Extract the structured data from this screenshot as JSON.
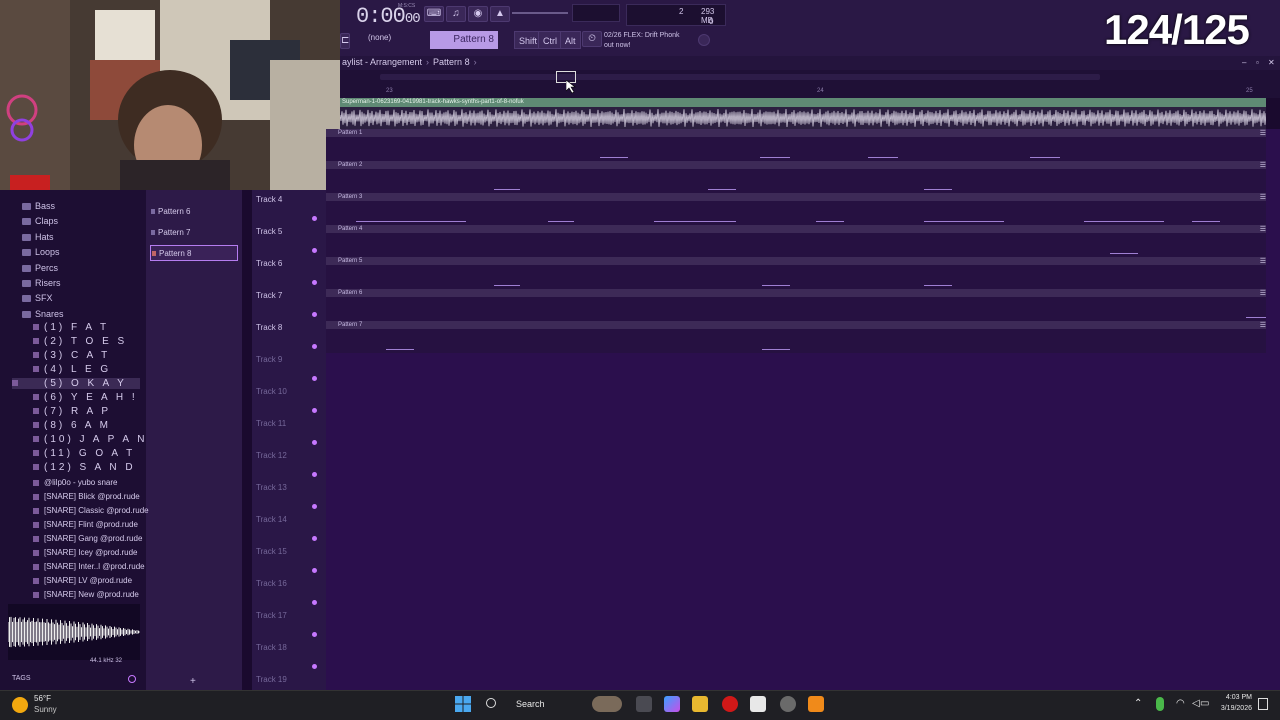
{
  "toolbar": {
    "time_main": "0:00",
    "time_sub": "00",
    "time_unit": "M:S:CS",
    "cpu_value": "2",
    "mem_value": "293 MB",
    "mem_sub": "0",
    "pattern_selector": "(none)",
    "pattern_current": "Pattern 8",
    "shift_label": "Shift",
    "ctrl_label": "Ctrl",
    "alt_label": "Alt",
    "news_line1": "02/26  FLEX: Drift Phonk",
    "news_line2": "out now!"
  },
  "overlay": {
    "counter": "124/125"
  },
  "playlist": {
    "breadcrumb_root": "aylist - Arrangement",
    "breadcrumb_current": "Pattern 8",
    "ruler_numbers": [
      "23",
      "24",
      "25"
    ],
    "audio_clip_label": "Superman-1-0623169-0419981-track-hawks-synths-part1-of-8-nofuk",
    "lanes": [
      {
        "label": "Pattern 1"
      },
      {
        "label": "Pattern 2"
      },
      {
        "label": "Pattern 3"
      },
      {
        "label": "Pattern 4"
      },
      {
        "label": "Pattern 5"
      },
      {
        "label": "Pattern 6"
      },
      {
        "label": "Pattern 7"
      }
    ],
    "tracks": [
      "Track 4",
      "Track 5",
      "Track 6",
      "Track 7",
      "Track 8",
      "Track 9",
      "Track 10",
      "Track 11",
      "Track 12",
      "Track 13",
      "Track 14",
      "Track 15",
      "Track 16",
      "Track 17",
      "Track 18",
      "Track 19"
    ]
  },
  "patterns": {
    "items": [
      "Pattern 6",
      "Pattern 7",
      "Pattern 8"
    ],
    "selected": "Pattern 8"
  },
  "browser": {
    "folders": [
      "Bass",
      "Claps",
      "Hats",
      "Loops",
      "Percs",
      "Risers",
      "SFX",
      "Snares"
    ],
    "snare_items": [
      "(1)  F A T",
      "(2)  T O E S",
      "(3)  C A T",
      "(4)  L E G",
      "(5)  O K A Y",
      "(6)  Y E A H !",
      "(7)  R A P",
      "(8)  6 A M",
      "(10)  J A P A N",
      "(11)  G O A T",
      "(12)  S A N D"
    ],
    "files": [
      "@lilp0o - yubo snare",
      "[SNARE] Blick @prod.rude",
      "[SNARE] Classic @prod.rude",
      "[SNARE] Flint @prod.rude",
      "[SNARE] Gang @prod.rude",
      "[SNARE] Icey @prod.rude",
      "[SNARE] Inter..l @prod.rude",
      "[SNARE] LV @prod.rude",
      "[SNARE] New @prod.rude"
    ],
    "sample_rate": "44.1 kHz 32",
    "tags_label": "TAGS"
  },
  "taskbar": {
    "temperature": "56°F",
    "condition": "Sunny",
    "search_label": "Search",
    "time": "4:03 PM",
    "date": "3/19/2026"
  },
  "colors": {
    "playlist_bg": "#2b0f4d",
    "lane_header": "#3d2a57",
    "accent": "#b89ae6",
    "audio_clip": "#5f8a74"
  }
}
